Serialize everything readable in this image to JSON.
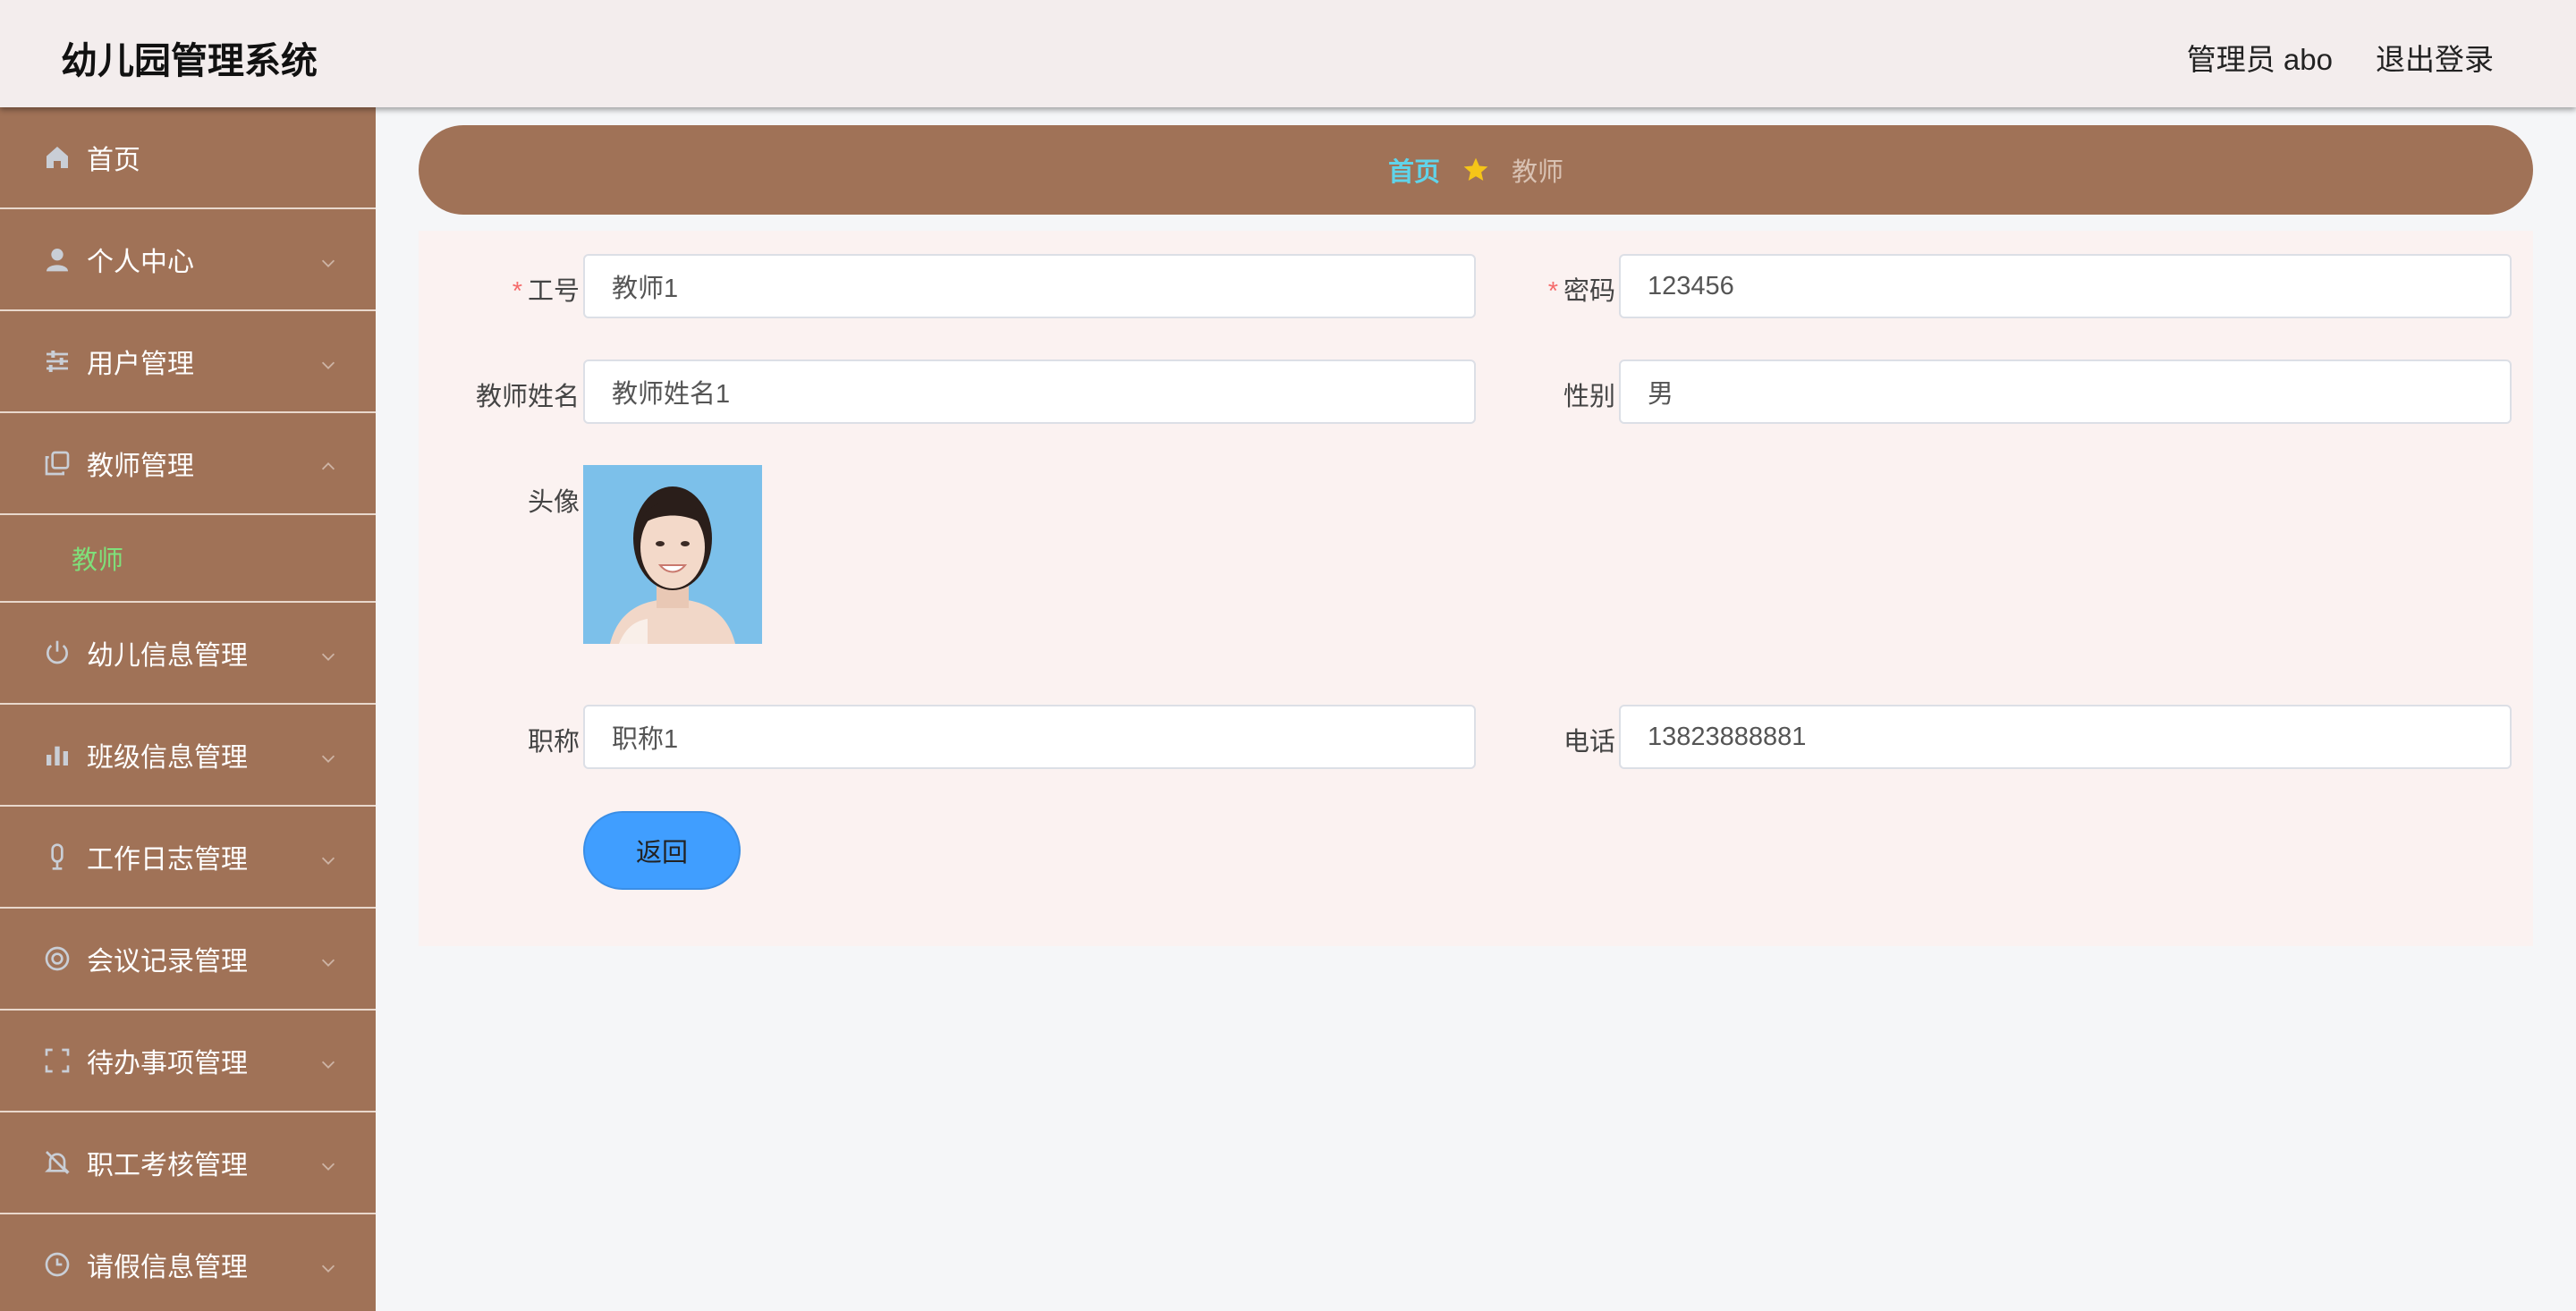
{
  "header": {
    "app_title": "幼儿园管理系统",
    "user_label": "管理员 abo",
    "logout_label": "退出登录"
  },
  "sidebar": {
    "items": [
      {
        "label": "首页",
        "icon": "home-icon"
      },
      {
        "label": "个人中心",
        "icon": "user-icon"
      },
      {
        "label": "用户管理",
        "icon": "sliders-icon"
      },
      {
        "label": "教师管理",
        "icon": "copy-icon",
        "expanded": true,
        "children": [
          {
            "label": "教师",
            "active": true
          }
        ]
      },
      {
        "label": "幼儿信息管理",
        "icon": "power-icon"
      },
      {
        "label": "班级信息管理",
        "icon": "bar-chart-icon"
      },
      {
        "label": "工作日志管理",
        "icon": "microphone-icon"
      },
      {
        "label": "会议记录管理",
        "icon": "lifebuoy-icon"
      },
      {
        "label": "待办事项管理",
        "icon": "fullscreen-icon"
      },
      {
        "label": "职工考核管理",
        "icon": "bell-off-icon"
      },
      {
        "label": "请假信息管理",
        "icon": "clock-icon"
      }
    ]
  },
  "breadcrumb": {
    "home": "首页",
    "current": "教师"
  },
  "form": {
    "gonghao": {
      "label": "工号",
      "value": "教师1",
      "required": true
    },
    "mima": {
      "label": "密码",
      "value": "123456",
      "required": true
    },
    "xingming": {
      "label": "教师姓名",
      "value": "教师姓名1"
    },
    "xingbie": {
      "label": "性别",
      "value": "男"
    },
    "touxiang": {
      "label": "头像"
    },
    "zhicheng": {
      "label": "职称",
      "value": "职称1"
    },
    "dianhua": {
      "label": "电话",
      "value": "13823888881"
    },
    "back_button": "返回"
  },
  "colors": {
    "sidebar_bg": "#a07257",
    "header_bg": "#f3eded",
    "accent_active": "#7fe07a",
    "breadcrumb_home": "#60d4ea",
    "button_primary": "#409eff",
    "required_mark": "#f56c6c"
  }
}
